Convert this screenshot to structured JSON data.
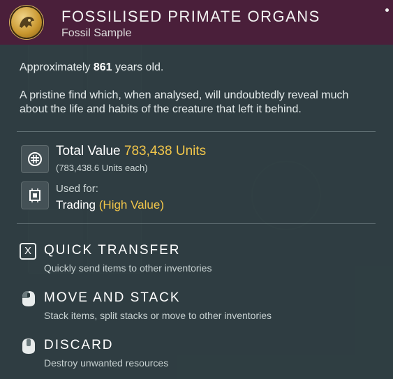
{
  "item": {
    "title": "FOSSILISED PRIMATE ORGANS",
    "category": "Fossil Sample",
    "age_prefix": "Approximately",
    "age_value": "861",
    "age_suffix": "years old.",
    "description": "A pristine find which, when analysed, will undoubtedly reveal much about the life and habits of the creature that left it behind."
  },
  "value": {
    "label": "Total Value",
    "amount": "783,438 Units",
    "each": "(783,438.6 Units each)",
    "icon": "units-icon"
  },
  "used_for": {
    "label": "Used for:",
    "value": "Trading",
    "highlight": "(High Value)",
    "icon": "trade-chip-icon"
  },
  "actions": [
    {
      "key": "X",
      "name": "QUICK TRANSFER",
      "hint": "Quickly send items to other inventories",
      "icon": "x-key-icon"
    },
    {
      "name": "MOVE AND STACK",
      "hint": "Stack items, split stacks or move to other inventories",
      "icon": "mouse-left-click-icon"
    },
    {
      "name": "DISCARD",
      "hint": "Destroy unwanted resources",
      "icon": "mouse-middle-click-icon"
    }
  ],
  "colors": {
    "header_bg": "#4a1f3a",
    "accent_gold": "#f2c64a",
    "panel_bg": "#303e42"
  }
}
